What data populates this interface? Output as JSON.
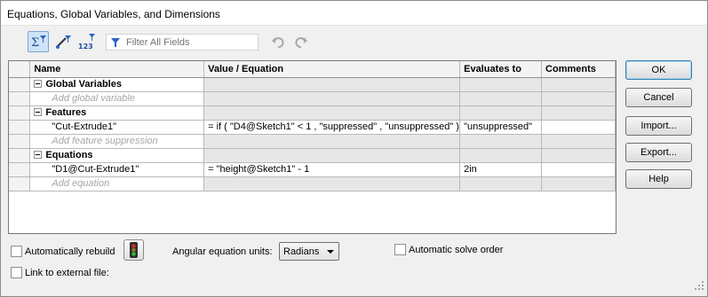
{
  "window": {
    "title": "Equations, Global Variables, and Dimensions"
  },
  "toolbar": {
    "filter_placeholder": "Filter All Fields",
    "icons": [
      "equation-view-icon",
      "sketch-equation-view-icon",
      "dimension-view-icon",
      "funnel-icon",
      "undo-icon",
      "redo-icon"
    ]
  },
  "grid": {
    "columns": [
      "Name",
      "Value / Equation",
      "Evaluates to",
      "Comments"
    ],
    "sections": [
      {
        "label": "Global Variables",
        "rows": [],
        "placeholder": "Add global variable"
      },
      {
        "label": "Features",
        "rows": [
          {
            "name": "\"Cut-Extrude1\"",
            "value": "= if ( \"D4@Sketch1\" < 1 , \"suppressed\" , \"unsuppressed\" )",
            "evaluates": "\"unsuppressed\"",
            "comment": ""
          }
        ],
        "placeholder": "Add feature suppression"
      },
      {
        "label": "Equations",
        "rows": [
          {
            "name": "\"D1@Cut-Extrude1\"",
            "value": "= \"height@Sketch1\" - 1",
            "evaluates": "2in",
            "comment": ""
          }
        ],
        "placeholder": "Add equation"
      }
    ]
  },
  "buttons": {
    "ok": "OK",
    "cancel": "Cancel",
    "import": "Import...",
    "export": "Export...",
    "help": "Help"
  },
  "options": {
    "auto_rebuild": "Automatically rebuild",
    "angular_units_label": "Angular equation units:",
    "angular_units_value": "Radians",
    "auto_solve_order": "Automatic solve order",
    "link_external": "Link to external file:"
  },
  "colors": {
    "accent_blue": "#3c7fb1",
    "grid_border": "#b9b9b9"
  }
}
